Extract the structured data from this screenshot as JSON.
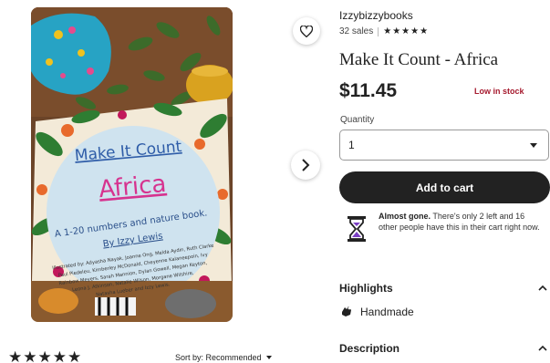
{
  "product": {
    "shop_name": "Izzybizzybooks",
    "sales": "32 sales",
    "rating_stars": "★★★★★",
    "title": "Make It Count - Africa",
    "price": "$11.45",
    "stock_status": "Low in stock",
    "quantity_label": "Quantity",
    "quantity_value": "1",
    "add_to_cart": "Add to cart",
    "almost_gone_bold": "Almost gone.",
    "almost_gone_text": "There's only 2 left and 16 other people have this in their cart right now.",
    "highlights_label": "Highlights",
    "highlight_item": "Handmade",
    "description_label": "Description"
  },
  "book_cover": {
    "line1": "Make It Count",
    "line2": "Africa",
    "subtitle": "A 1-20 numbers and nature book.",
    "author": "By Izzy Lewis",
    "illustrators": [
      "Illustrated by: Adyasha Nayak, Joanne Ong, Melda Aydin, Ruth Clarke",
      "Paul Piedeleu, Kimberley McDonald, Cheyenne Kalaneepoin, Ivy",
      "Rainbow Meyers, Sarah Mannion, Dylan Gowell, Megan Keyton,",
      "Leona J. Atkinson, Natalie Wilson, Morgane Wilshire,",
      "Natasha Lueber and Izzy Lewis."
    ]
  },
  "reviews": {
    "stars": "★★★★★",
    "sort_label": "Sort by: Recommended"
  },
  "colors": {
    "stock_red": "#a61a2e",
    "button_dark": "#222222"
  },
  "icons": [
    "heart-icon",
    "chevron-right-icon",
    "hourglass-icon",
    "handmade-icon",
    "chevron-up-icon",
    "chevron-down-icon"
  ]
}
